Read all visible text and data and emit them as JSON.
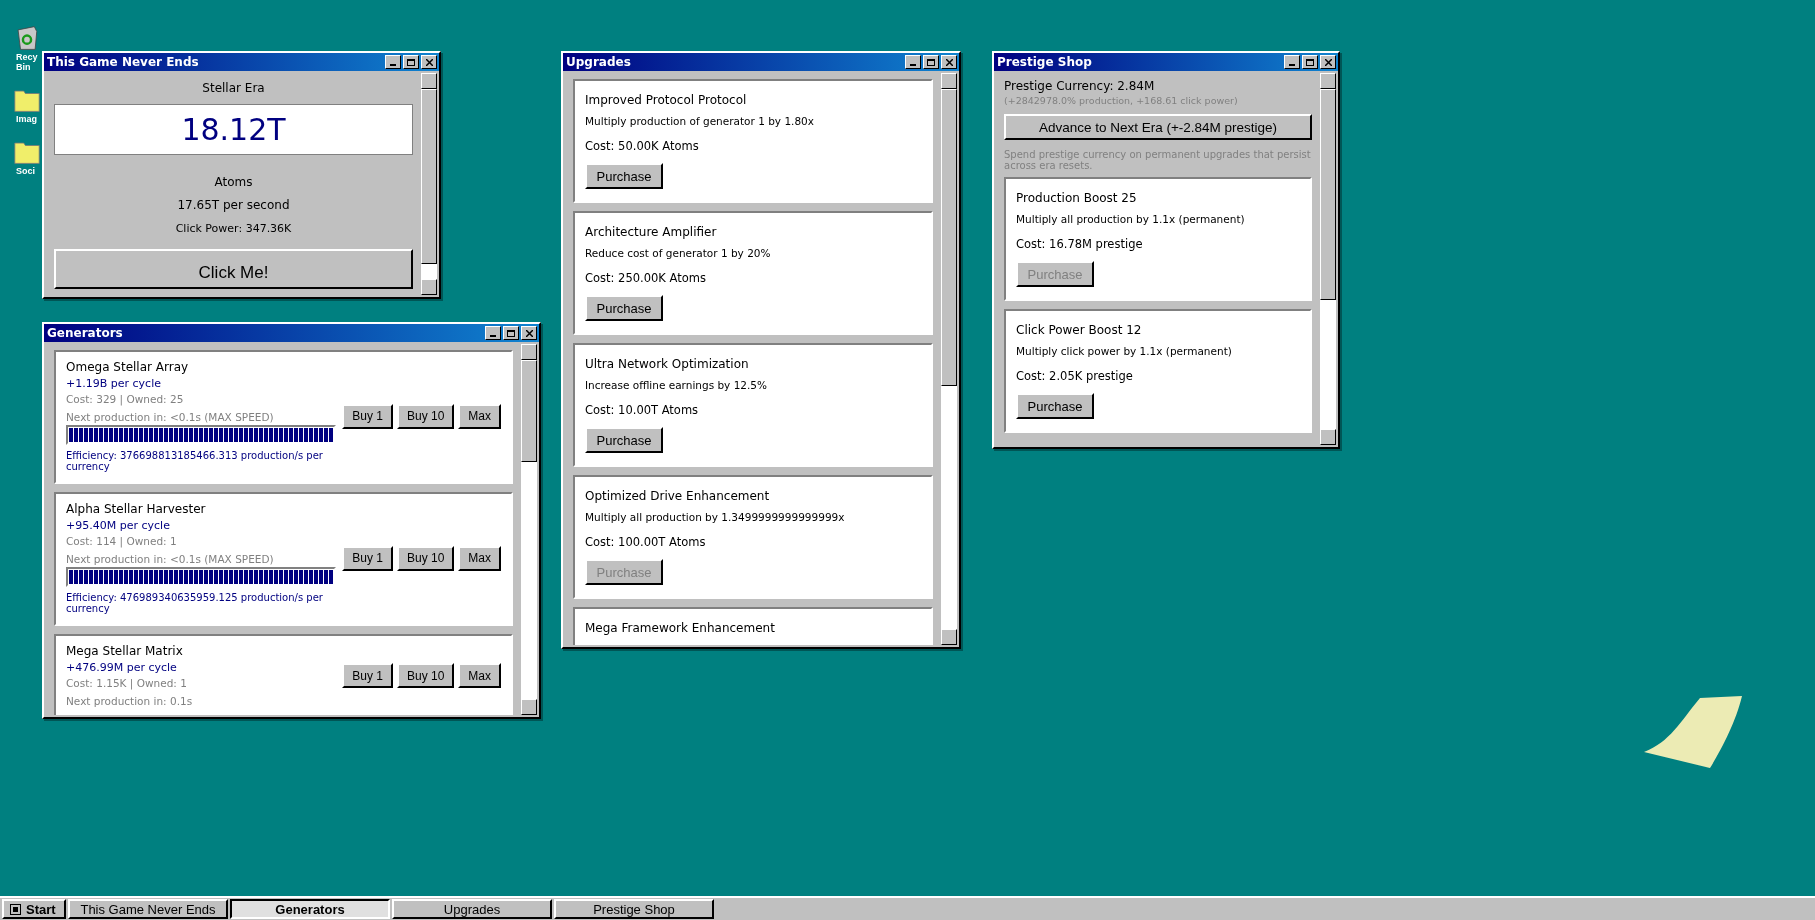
{
  "desktop_icons": [
    {
      "kind": "recycle",
      "label_lines": [
        "Recy",
        "Bin"
      ]
    },
    {
      "kind": "folder",
      "label_lines": [
        "Imag"
      ]
    },
    {
      "kind": "folder",
      "label_lines": [
        "Soci"
      ]
    }
  ],
  "main_window": {
    "title": "This Game Never Ends",
    "era": "Stellar Era",
    "amount": "18.12T",
    "currency": "Atoms",
    "rate": "17.65T per second",
    "click_power": "Click Power: 347.36K",
    "click_button": "Click Me!"
  },
  "generators_window": {
    "title": "Generators",
    "items": [
      {
        "name": "Omega Stellar Array",
        "rate": "+1.19B per cycle",
        "cost_owned": "Cost: 329 | Owned: 25",
        "next": "Next production in: <0.1s (MAX SPEED)",
        "level": 1,
        "efficiency": "Efficiency: 376698813185466.313 production/s per currency",
        "buttons": [
          "Buy 1",
          "Buy 10",
          "Max"
        ]
      },
      {
        "name": "Alpha Stellar Harvester",
        "rate": "+95.40M per cycle",
        "cost_owned": "Cost: 114 | Owned: 1",
        "next": "Next production in: <0.1s (MAX SPEED)",
        "level": 1,
        "efficiency": "Efficiency: 476989340635959.125 production/s per currency",
        "buttons": [
          "Buy 1",
          "Buy 10",
          "Max"
        ]
      },
      {
        "name": "Mega Stellar Matrix",
        "rate": "+476.99M per cycle",
        "cost_owned": "Cost: 1.15K | Owned: 1",
        "next": "Next production in: 0.1s",
        "buttons": [
          "Buy 1",
          "Buy 10",
          "Max"
        ]
      }
    ]
  },
  "upgrades_window": {
    "title": "Upgrades",
    "items": [
      {
        "name": "Improved Protocol Protocol",
        "description": "Multiply production of generator 1 by 1.80x",
        "cost": "Cost: 50.00K Atoms",
        "button": {
          "label": "Purchase",
          "disabled": false
        }
      },
      {
        "name": "Architecture Amplifier",
        "description": "Reduce cost of generator 1 by 20%",
        "cost": "Cost: 250.00K Atoms",
        "button": {
          "label": "Purchase",
          "disabled": false
        }
      },
      {
        "name": "Ultra Network Optimization",
        "description": "Increase offline earnings by 12.5%",
        "cost": "Cost: 10.00T Atoms",
        "button": {
          "label": "Purchase",
          "disabled": false
        }
      },
      {
        "name": "Optimized Drive Enhancement",
        "description": "Multiply all production by 1.3499999999999999x",
        "cost": "Cost: 100.00T Atoms",
        "button": {
          "label": "Purchase",
          "disabled": true
        }
      },
      {
        "name": "Mega Framework Enhancement"
      }
    ]
  },
  "prestige_window": {
    "title": "Prestige Shop",
    "currency": "Prestige Currency: 2.84M",
    "bonus": "(+2842978.0% production, +168.61 click power)",
    "advance_button": "Advance to Next Era (+-2.84M prestige)",
    "note": "Spend prestige currency on permanent upgrades that persist across era resets.",
    "items": [
      {
        "name": "Production Boost 25",
        "description": "Multiply all production by 1.1x (permanent)",
        "cost": "Cost: 16.78M prestige",
        "button": {
          "label": "Purchase",
          "disabled": true
        }
      },
      {
        "name": "Click Power Boost 12",
        "description": "Multiply click power by 1.1x (permanent)",
        "cost": "Cost: 2.05K prestige",
        "button": {
          "label": "Purchase",
          "disabled": false
        }
      }
    ]
  },
  "taskbar": {
    "start": "Start",
    "tasks": [
      {
        "label": "This Game Never Ends",
        "selected": false
      },
      {
        "label": "Generators",
        "selected": true
      },
      {
        "label": "Upgrades",
        "selected": false
      },
      {
        "label": "Prestige Shop",
        "selected": false
      }
    ]
  }
}
